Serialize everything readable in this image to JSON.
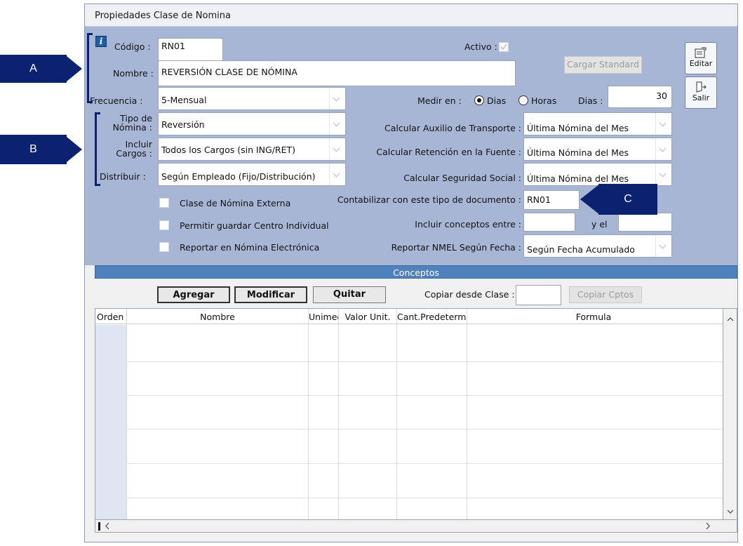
{
  "window": {
    "title": "Propiedades Clase de Nomina"
  },
  "form": {
    "codigo_label": "Código :",
    "codigo_value": "RN01",
    "activo_label": "Activo :",
    "nombre_label": "Nombre :",
    "nombre_value": "REVERSIÓN CLASE DE NÓMINA",
    "cargar_standard": "Cargar Standard",
    "frecuencia_label": "Frecuencia :",
    "frecuencia_value": "5-Mensual",
    "medir_label": "Medir en :",
    "radio_dias": "Dias",
    "radio_horas": "Horas",
    "dias_label": "Dias :",
    "dias_value": "30",
    "tipo_label_1": "Tipo de",
    "tipo_label_2": "Nómina :",
    "tipo_value": "Reversión",
    "incluir_label_1": "Incluir",
    "incluir_label_2": "Cargos :",
    "incluir_value": "Todos los Cargos (sin ING/RET)",
    "distribuir_label": "Distribuir :",
    "distribuir_value": "Según Empleado (Fijo/Distribución)",
    "aux_label": "Calcular Auxilio de Transporte :",
    "aux_value": "Última Nómina del Mes",
    "ret_label": "Calcular Retención en la Fuente :",
    "ret_value": "Última Nómina del Mes",
    "seg_label": "Calcular Seguridad Social :",
    "seg_value": "Última Nómina del Mes",
    "externa_label": "Clase de Nómina Externa",
    "centro_label": "Permitir guardar Centro Individual",
    "electronica_label": "Reportar en Nómina Electrónica",
    "contab_label": "Contabilizar con este tipo de documento :",
    "contab_value": "RN01",
    "conceptos_entre_label": "Incluir conceptos entre :",
    "y_el_label": "y el",
    "nmel_label": "Reportar NMEL Según Fecha :",
    "nmel_value": "Según Fecha Acumulado"
  },
  "side_buttons": {
    "editar": "Editar",
    "salir": "Salir"
  },
  "conceptos": {
    "header": "Conceptos",
    "agregar": "Agregar",
    "modificar": "Modificar",
    "quitar": "Quitar",
    "copiar_label": "Copiar desde Clase :",
    "copiar_btn": "Copiar Cptos",
    "columns": [
      "Orden",
      "Nombre",
      "Unimed",
      "Valor Unit.",
      "Cant.Predetermi",
      "Formula"
    ]
  },
  "callouts": {
    "a": "A",
    "b": "B",
    "c": "C"
  },
  "icons": [
    "info-icon",
    "edit-icon",
    "exit-icon",
    "chevron-up-icon",
    "chevron-down-icon",
    "chevron-left-icon",
    "chevron-right-icon"
  ],
  "colors": {
    "panel": "#a8b6d6",
    "header_blue": "#4f81bd",
    "callout": "#0b2270"
  }
}
